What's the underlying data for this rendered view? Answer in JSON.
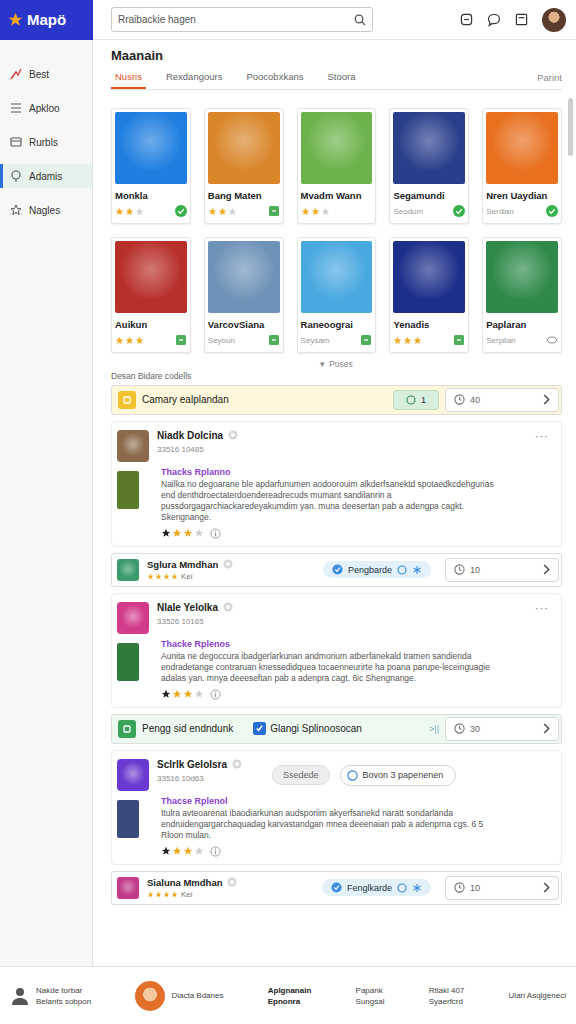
{
  "app": {
    "logo": "Mapö"
  },
  "search": {
    "placeholder": "Rraibackie hagen"
  },
  "sidebar": {
    "items": [
      {
        "label": "Best",
        "selected": false
      },
      {
        "label": "Apkloo",
        "selected": false
      },
      {
        "label": "Rurbls",
        "selected": false
      },
      {
        "label": "Adamis",
        "selected": true
      },
      {
        "label": "Nagles",
        "selected": false
      }
    ]
  },
  "page": {
    "title": "Maanain",
    "tabs": [
      {
        "label": "Nusris",
        "selected": true
      },
      {
        "label": "Rexdangours",
        "selected": false
      },
      {
        "label": "Poocobxkans",
        "selected": false
      },
      {
        "label": "Stoora",
        "selected": false
      }
    ],
    "tab_right": "Parint"
  },
  "games": [
    {
      "title": "Monkla",
      "kind": "rated",
      "stars": 2,
      "badge": "check",
      "color": "#1f7fe0"
    },
    {
      "title": "Bang Maten",
      "kind": "rated",
      "stars": 2,
      "badge": "square",
      "color": "#d9862a"
    },
    {
      "title": "Mvadm Wann",
      "kind": "rated",
      "stars": 2,
      "badge": "none",
      "color": "#6bb34a"
    },
    {
      "title": "Segamundi",
      "kind": "subtitled",
      "subtitle": "Seodum",
      "badge": "check",
      "color": "#2a3f8c"
    },
    {
      "title": "Nren Uaydian",
      "kind": "subtitled",
      "subtitle": "Serdian",
      "badge": "check",
      "color": "#e8701f"
    },
    {
      "title": "Auikun",
      "kind": "rated",
      "stars": 3,
      "badge": "square",
      "color": "#b8302a"
    },
    {
      "title": "VarcovSiana",
      "kind": "subtitled",
      "subtitle": "Seyoun",
      "badge": "square",
      "color": "#6f93b8"
    },
    {
      "title": "Raneoograi",
      "kind": "subtitled",
      "subtitle": "Seysam",
      "badge": "square",
      "color": "#48a8e0"
    },
    {
      "title": "Yenadis",
      "kind": "rated",
      "stars": 3,
      "badge": "square",
      "color": "#1d2f8a"
    },
    {
      "title": "Paplaran",
      "kind": "subtitled",
      "subtitle": "Serpilan",
      "badge": "outline",
      "color": "#2f8a4a"
    }
  ],
  "more": {
    "icon": "▾",
    "label": "Puses"
  },
  "section_label": "Desan Bidare codells",
  "feed": [
    {
      "kind": "strip",
      "color": "#fff7dc",
      "icon_color": "#f2c230",
      "label": "Camary ealplandan",
      "pill": {
        "text": "1",
        "color": "#d8efdd"
      },
      "count": "40"
    },
    {
      "kind": "post",
      "avatar_color": "#8a6a4a",
      "name": "Niadk Dolcina",
      "meta": "33516 10485",
      "menu": "···",
      "thumb_color": "#5a7a2a",
      "title": "Thacks Rplanno",
      "body": "Nailka no degoarane ble apdarfunumen aodoorouim alkderfsanektd spotaedkcdehgurias end denthdroectaterdoendereadrecuds mumant sandilanrin a pussdorgagarchiackaredeyakumdim yan. muna deesertan pab a adengpa cagkt. Skengnange.",
      "stars": 3
    },
    {
      "kind": "row",
      "avatar_color": "#3a9a6a",
      "name": "Sglura Mmdhan",
      "stars": 4,
      "tag": "Kei",
      "pill": {
        "text": "Pengbarde",
        "color": "#e3f1fb"
      },
      "count": "10"
    },
    {
      "kind": "post",
      "avatar_color": "#d23a8a",
      "name": "Nlale Yelolka",
      "meta": "33526 10165",
      "menu": "···",
      "thumb_color": "#2f7a3a",
      "title": "Thacke Rplenos",
      "body": "Aunita ne degoccura ibadgerlarkunan andmorium atberfanekald tramen sandienda endradetange contraruan knessedidquea tocaenneurirte ha poana parupe-leceinguagie adalas yan. mnya deeeseftan pab a adenpra cagt. 6ic Shengnange.",
      "stars": 3
    },
    {
      "kind": "strip",
      "color": "#eefaf1",
      "icon_color": "#3aa35a",
      "label": "Pengg sid endndunk",
      "check": {
        "label": "Glangi Splinoosocan",
        "checked": true
      },
      "extra": ">||",
      "count": "30"
    },
    {
      "kind": "post",
      "avatar_color": "#6a3ad0",
      "name": "Sclrlk Gelolsra",
      "meta": "33516 10d63",
      "tags": [
        {
          "text": "Ssedede",
          "kind": "grey"
        },
        {
          "text": "Bovon 3 papenenen",
          "kind": "outline"
        }
      ],
      "thumb_color": "#3a4a7a",
      "title": "Thacse Rplenol",
      "body": "Itulra avteoarenat ibaodiarkunan audsporiim akyerfsanekd naratt sondarlanda endruidengargarchaquadag karvastandgan mnea deeenaian pab a adenprna cgs. 6 5 Rloon mulan.",
      "stars": 3
    },
    {
      "kind": "row",
      "avatar_color": "#c23a8a",
      "name": "Sialuna Mmdhan",
      "stars": 4,
      "tag": "Kei",
      "pill": {
        "text": "Fenglkarde",
        "color": "#e3f1fb"
      },
      "count": "10"
    }
  ],
  "bottom_bar": {
    "items": [
      {
        "kind": "user",
        "lines": [
          "Nakde torbar",
          "Belants sobpon"
        ],
        "selected": false
      },
      {
        "kind": "avatar",
        "lines": [
          "Diacta Bdanes"
        ],
        "selected": false
      },
      {
        "kind": "text",
        "lines": [
          "Aplgnanain",
          "Epnonra"
        ],
        "selected": true
      },
      {
        "kind": "text",
        "lines": [
          "Papank",
          "Sungsal"
        ],
        "selected": false
      },
      {
        "kind": "text",
        "lines": [
          "Rtlakl 407",
          "Syaerfcrd"
        ],
        "selected": false
      },
      {
        "kind": "text",
        "lines": [
          "Ulari Asqlgenecl"
        ],
        "selected": false
      }
    ]
  }
}
